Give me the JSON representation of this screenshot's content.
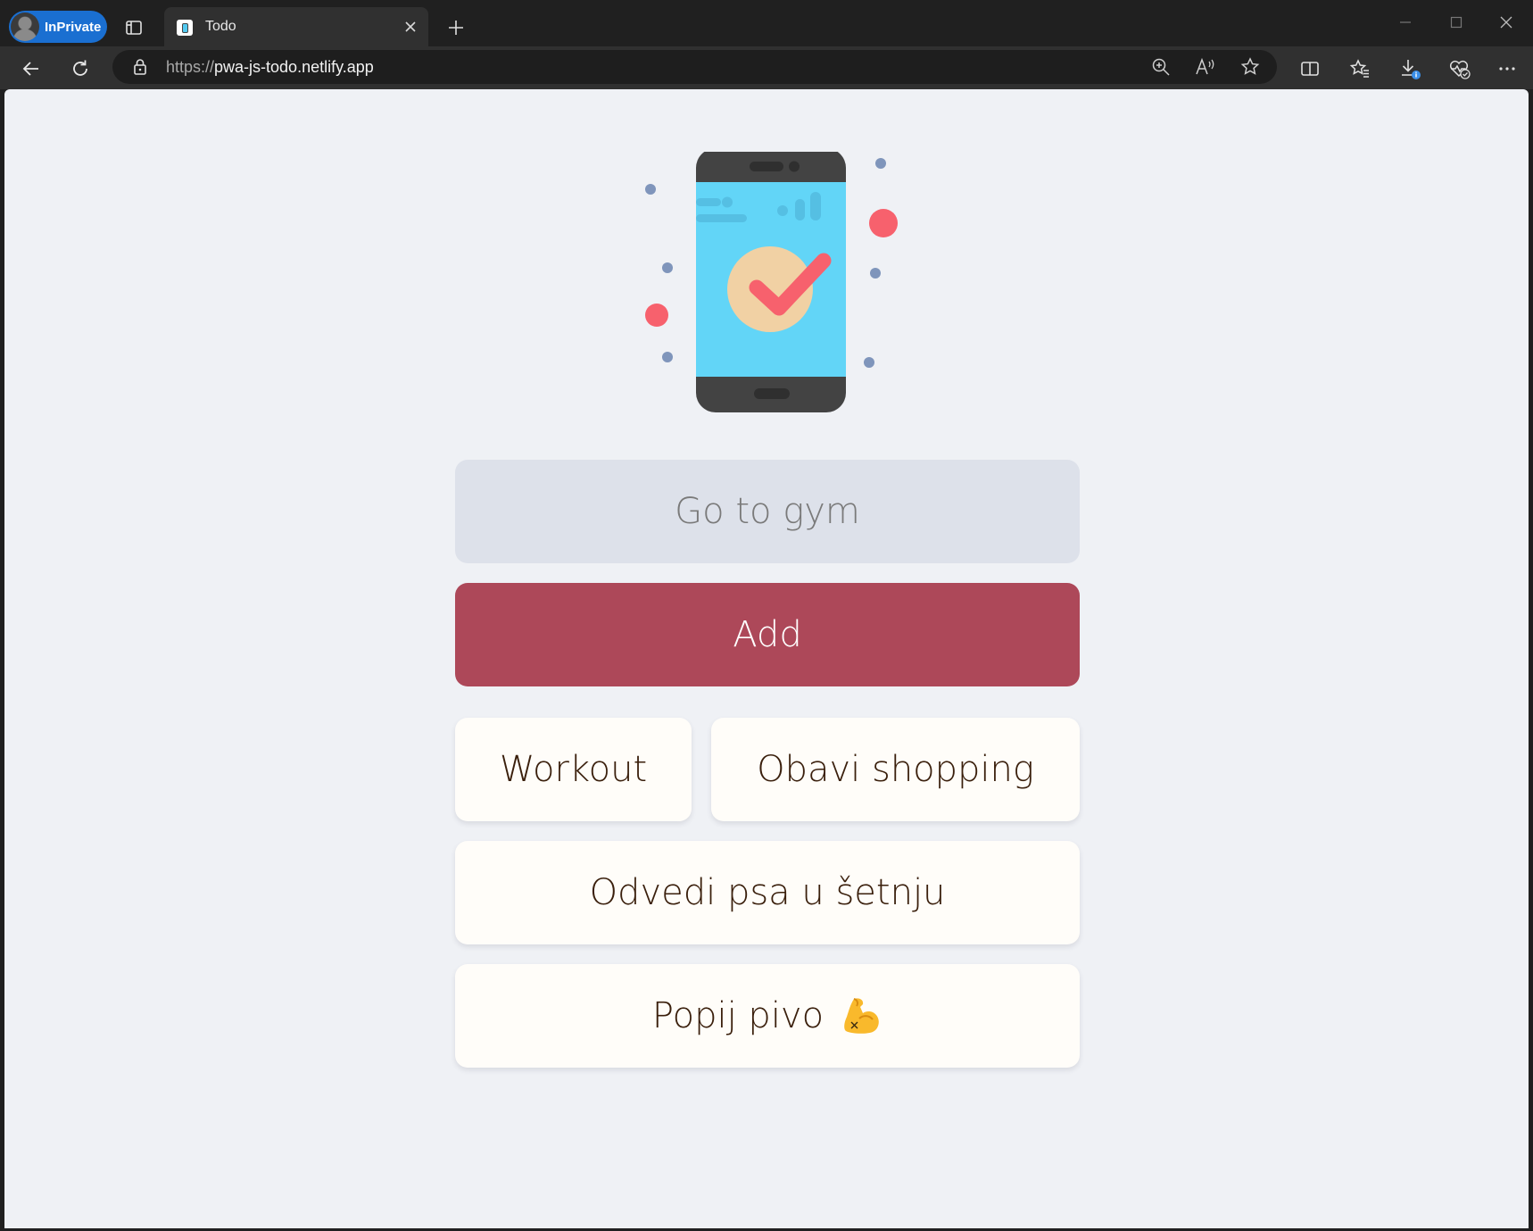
{
  "browser": {
    "profile_badge": "InPrivate",
    "tab": {
      "title": "Todo"
    },
    "address_bar": {
      "scheme": "https://",
      "host": "pwa-js-todo.netlify.app"
    },
    "icons": [
      "tab-actions-icon",
      "close-icon",
      "plus-icon",
      "minimize-icon",
      "maximize-icon",
      "close-window-icon",
      "back-icon",
      "refresh-icon",
      "lock-icon",
      "zoom-icon",
      "read-aloud-icon",
      "star-icon",
      "split-screen-icon",
      "favorites-icon",
      "downloads-icon",
      "browser-essentials-icon",
      "more-icon"
    ]
  },
  "app": {
    "input": {
      "placeholder": "Go to gym",
      "value": ""
    },
    "add_button": "Add",
    "todos": [
      {
        "text": "Workout"
      },
      {
        "text": "Obavi shopping"
      },
      {
        "text": "Odvedi psa u šetnju"
      },
      {
        "text": "Popij pivo"
      }
    ],
    "colors": {
      "add_button": "#ad4859",
      "input_bg": "#dde1ea",
      "page_bg": "#eff1f5",
      "item_bg": "#fffdf9",
      "item_text": "#3a1f0c"
    }
  }
}
